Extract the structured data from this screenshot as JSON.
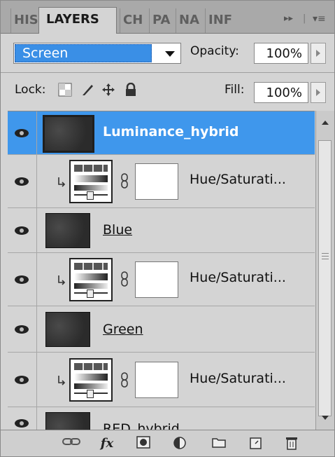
{
  "tabs": [
    "HIS",
    "LAYERS",
    "CH",
    "PA",
    "NA",
    "INF"
  ],
  "blend_mode": "Screen",
  "opacity": {
    "label": "Opacity:",
    "value": "100%"
  },
  "lock": {
    "label": "Lock:"
  },
  "fill": {
    "label": "Fill:",
    "value": "100%"
  },
  "layers": [
    {
      "name": "Luminance_hybrid",
      "kind": "image",
      "selected": true
    },
    {
      "name": "Hue/Saturati...",
      "kind": "adjustment",
      "clipped": true
    },
    {
      "name": "Blue",
      "kind": "image"
    },
    {
      "name": "Hue/Saturati...",
      "kind": "adjustment",
      "clipped": true
    },
    {
      "name": "Green",
      "kind": "image"
    },
    {
      "name": "Hue/Saturati...",
      "kind": "adjustment",
      "clipped": true
    },
    {
      "name": "RED_hybrid",
      "kind": "image"
    }
  ],
  "colors": {
    "selection": "#3f97ec",
    "panel": "#d4d4d4",
    "tabbar": "#a9a9a9"
  },
  "icons": [
    "eye-icon",
    "link-icon",
    "fx-icon",
    "mask-icon",
    "adjustment-icon",
    "folder-icon",
    "new-layer-icon",
    "trash-icon",
    "panel-menu-icon",
    "collapse-icon"
  ]
}
